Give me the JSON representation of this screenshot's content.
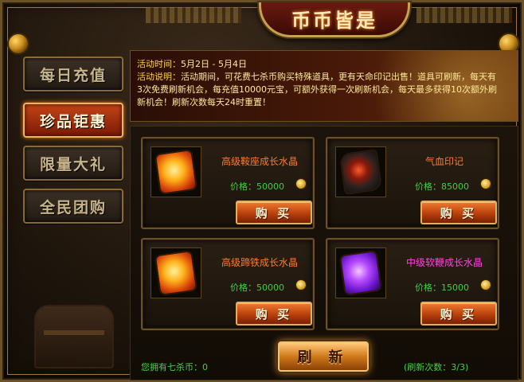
{
  "title": "币币皆是",
  "sidebar": {
    "items": [
      {
        "label": "每日充值",
        "active": false
      },
      {
        "label": "珍品钜惠",
        "active": true
      },
      {
        "label": "限量大礼",
        "active": false
      },
      {
        "label": "全民团购",
        "active": false
      }
    ]
  },
  "info": {
    "time_label": "活动时间：",
    "time_value": "5月2日 - 5月4日",
    "desc_label": "活动说明：",
    "desc_value": "活动期间，可花费七杀币购买特殊道具，更有天命印记出售！道具可刷新，每天有3次免费刷新机会，每充值10000元宝，可额外获得一次刷新机会，每天最多获得10次额外刷新机会！刷新次数每天24时重置！"
  },
  "items": [
    {
      "name": "高级鞍座成长水晶",
      "price_label": "价格：",
      "price": "50000",
      "buy_label": "购 买",
      "icon": "orange-crystal-icon",
      "name_color": "orange"
    },
    {
      "name": "气血印记",
      "price_label": "价格：",
      "price": "85000",
      "buy_label": "购 买",
      "icon": "blood-seal-icon",
      "name_color": "orange"
    },
    {
      "name": "高级蹄铁成长水晶",
      "price_label": "价格：",
      "price": "50000",
      "buy_label": "购 买",
      "icon": "orange-crystal-icon",
      "name_color": "orange"
    },
    {
      "name": "中级软鞭成长水晶",
      "price_label": "价格：",
      "price": "15000",
      "buy_label": "购 买",
      "icon": "purple-crystal-icon",
      "name_color": "magenta"
    }
  ],
  "footer": {
    "owned_label": "您拥有七杀币：",
    "owned_value": "0",
    "refresh_label": "刷 新",
    "refresh_count": "(刷新次数：3/3)"
  },
  "colors": {
    "accent_red": "#c44418",
    "gold_border": "#c9a04d",
    "price_green": "#3ad43a",
    "name_orange": "#ff7a2a",
    "name_magenta": "#ff44e0"
  }
}
